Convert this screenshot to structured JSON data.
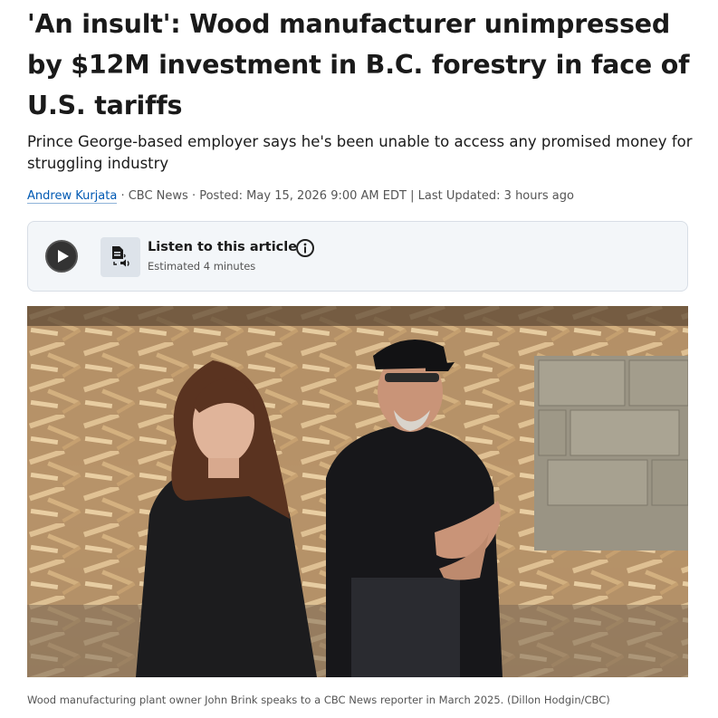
{
  "article": {
    "headline_lines": [
      "'An insult': Wood manufacturer unimpressed",
      "by $12M investment in B.C. forestry in face of",
      "U.S. tariffs"
    ],
    "deck_lines": [
      "Prince George-based employer says he's been unable to access any promised money for",
      "struggling industry"
    ],
    "byline": {
      "author": "Andrew Kurjata",
      "source": " · CBC News · ",
      "posted": "Posted: May 15, 2026 9:00 AM EDT",
      "separator": " | ",
      "updated": "Last Updated: 3 hours ago"
    }
  },
  "listen": {
    "title": "Listen to this article",
    "estimate": "Estimated 4 minutes",
    "play_icon": "play-icon",
    "tts_icon": "text-to-speech-icon",
    "info_icon": "info-icon"
  },
  "photo": {
    "caption": "Wood manufacturing plant owner John Brink speaks to a CBC News reporter in March 2025. (Dillon Hodgin/CBC)"
  },
  "colors": {
    "author_link": "#0059b3",
    "listen_bg": "#f3f6f9",
    "text": "#1a1a1a",
    "muted": "#555555"
  }
}
